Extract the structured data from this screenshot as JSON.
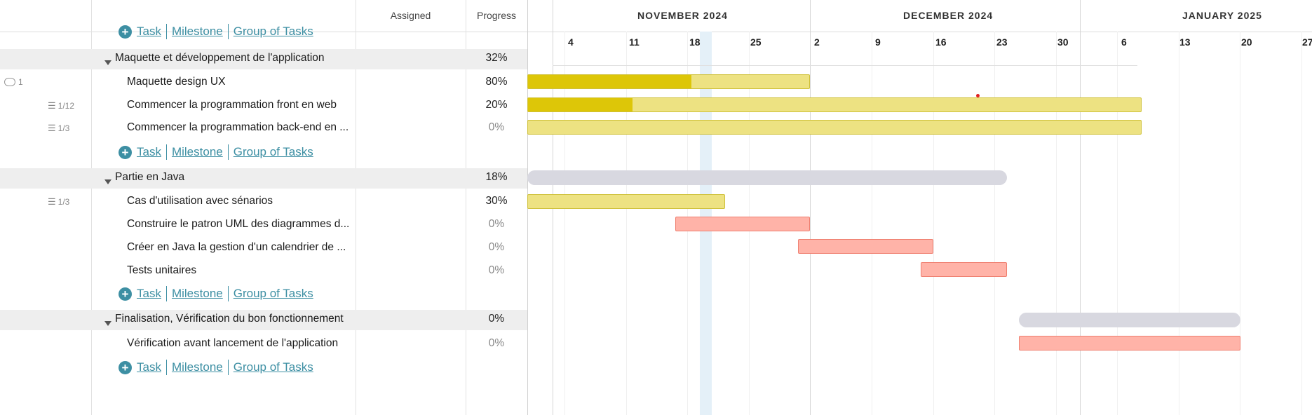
{
  "header": {
    "assigned_label": "Assigned",
    "progress_label": "Progress"
  },
  "timeline": {
    "months": [
      "NOVEMBER 2024",
      "DECEMBER 2024",
      "JANUARY 2025"
    ],
    "days": [
      "4",
      "11",
      "18",
      "25",
      "2",
      "9",
      "16",
      "23",
      "30",
      "6",
      "13",
      "20",
      "27"
    ]
  },
  "add_row": {
    "task": "Task",
    "milestone": "Milestone",
    "group": "Group of Tasks"
  },
  "groups": [
    {
      "name": "Maquette et développement de l'application",
      "progress": "32%",
      "tasks": [
        {
          "name": "Maquette design UX",
          "progress": "80%",
          "meta": "1",
          "meta_type": "comment",
          "fill": 0.58
        },
        {
          "name": "Commencer la programmation front en web",
          "progress": "20%",
          "meta": "1/12",
          "meta_type": "checklist",
          "fill": 0.17
        },
        {
          "name": "Commencer la programmation back-end en ...",
          "progress": "0%",
          "meta": "1/3",
          "meta_type": "checklist",
          "fill": 0
        }
      ]
    },
    {
      "name": "Partie en Java",
      "progress": "18%",
      "tasks": [
        {
          "name": "Cas d'utilisation avec sénarios",
          "progress": "30%",
          "meta": "1/3",
          "meta_type": "checklist",
          "fill": 0
        },
        {
          "name": "Construire le patron UML des diagrammes d...",
          "progress": "0%"
        },
        {
          "name": "Créer en Java la gestion d'un calendrier de ...",
          "progress": "0%"
        },
        {
          "name": "Tests unitaires",
          "progress": "0%"
        }
      ]
    },
    {
      "name": "Finalisation, Vérification du bon fonctionnement",
      "progress": "0%",
      "tasks": [
        {
          "name": "Vérification avant lancement de l'application",
          "progress": "0%"
        }
      ]
    }
  ],
  "colors": {
    "task_bar": "#ede282",
    "task_fill": "#ddc608",
    "unstarted_bar": "#ffb3a8",
    "group_bar": "#d8d8e0",
    "link": "#3d8fa3",
    "today": "#e4f0f8"
  }
}
